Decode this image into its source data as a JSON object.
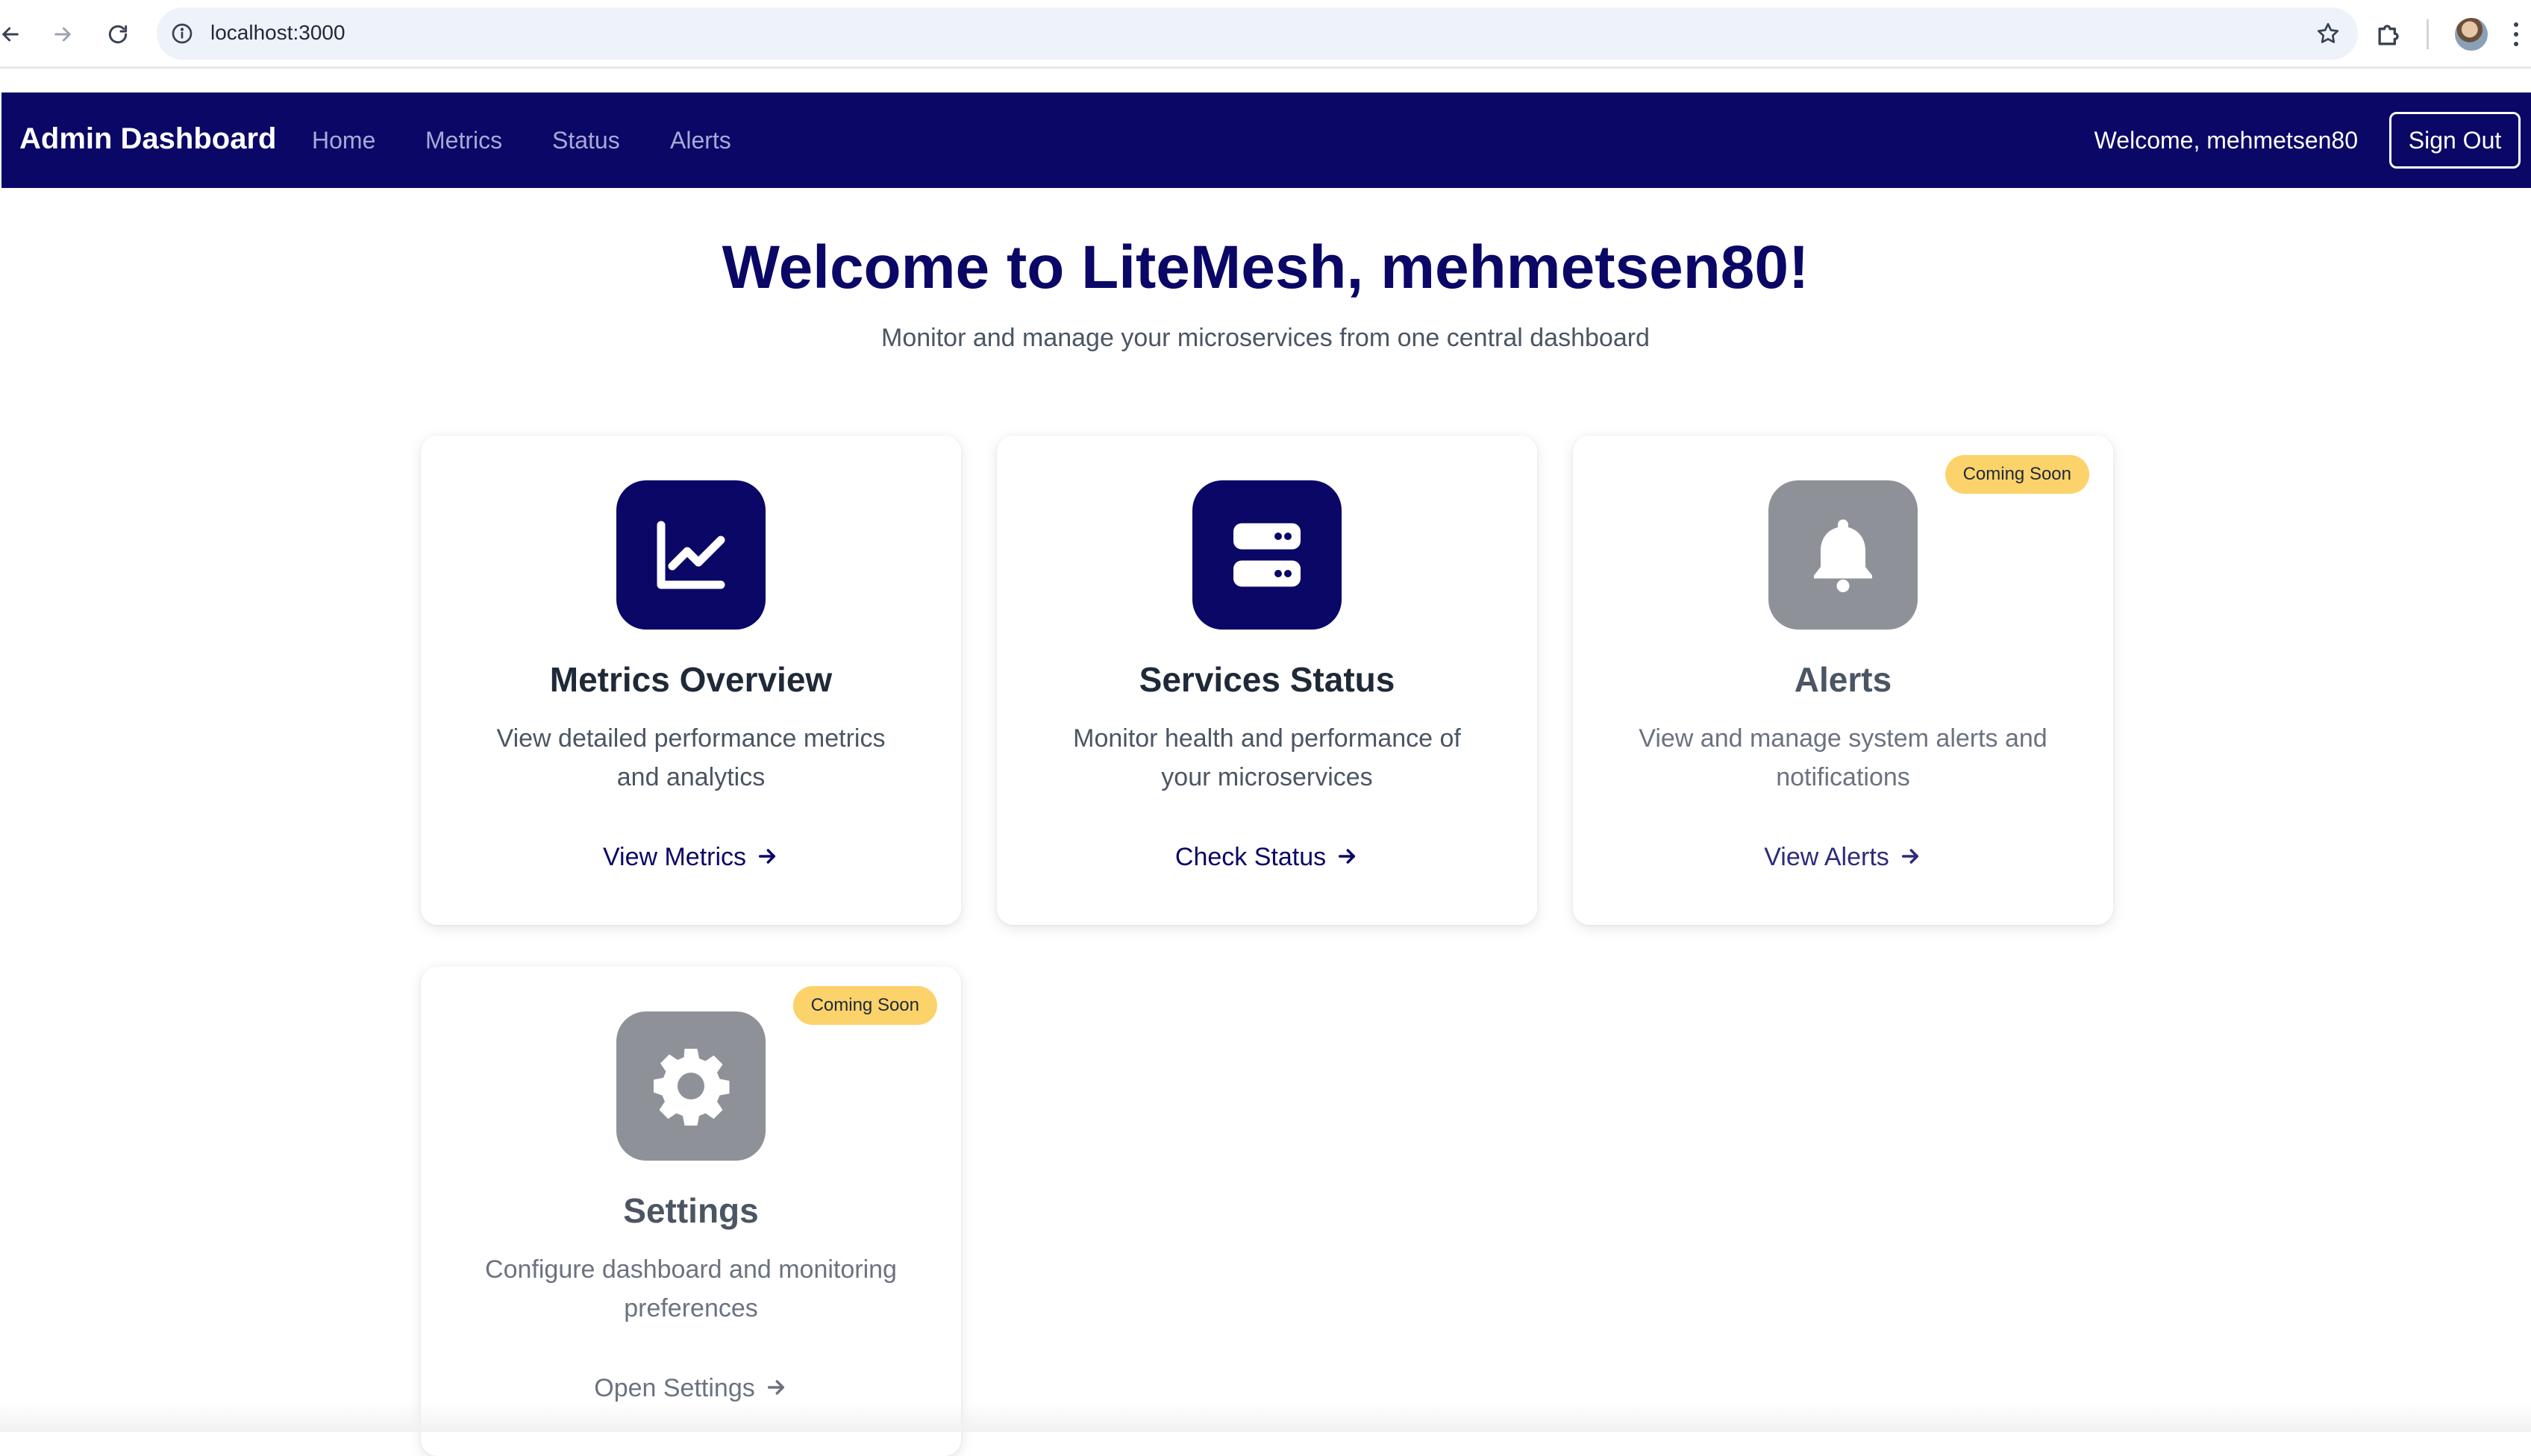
{
  "browser": {
    "url": "localhost:3000"
  },
  "navbar": {
    "brand": "Admin Dashboard",
    "links": [
      "Home",
      "Metrics",
      "Status",
      "Alerts"
    ],
    "welcome": "Welcome, mehmetsen80",
    "sign_out": "Sign Out",
    "bg_color": "#0a0766"
  },
  "hero": {
    "title": "Welcome to LiteMesh, mehmetsen80!",
    "subtitle": "Monitor and manage your microservices from one central dashboard"
  },
  "cards": [
    {
      "title": "Metrics Overview",
      "description": "View detailed performance metrics and analytics",
      "link": "View Metrics",
      "icon": "line-chart-icon",
      "icon_bg": "#0a0766",
      "badge": ""
    },
    {
      "title": "Services Status",
      "description": "Monitor health and performance of your microservices",
      "link": "Check Status",
      "icon": "server-icon",
      "icon_bg": "#0a0766",
      "badge": ""
    },
    {
      "title": "Alerts",
      "description": "View and manage system alerts and notifications",
      "link": "View Alerts",
      "icon": "bell-icon",
      "icon_bg": "#8e9298",
      "badge": "Coming Soon"
    },
    {
      "title": "Settings",
      "description": "Configure dashboard and monitoring preferences",
      "link": "Open Settings",
      "icon": "gear-icon",
      "icon_bg": "#8e9298",
      "badge": "Coming Soon"
    }
  ],
  "colors": {
    "accent": "#0a0766",
    "badge": "#fbd36a",
    "disabled_icon": "#8e9298"
  }
}
